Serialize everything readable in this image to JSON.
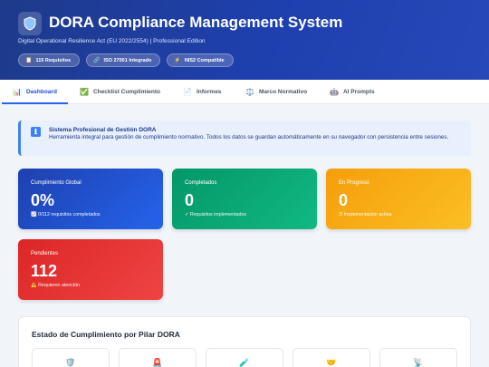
{
  "header": {
    "logo_icon": "shield-icon",
    "title": "DORA Compliance Management System",
    "subtitle": "Digital Operational Resilience Act (EU 2022/2554) | Professional Edition",
    "pills": [
      {
        "icon": "📋",
        "label": "115 Requisitos"
      },
      {
        "icon": "🔗",
        "label": "ISO 27001 Integrado"
      },
      {
        "icon": "⚡",
        "label": "NIS2 Compatible"
      }
    ]
  },
  "tabs": [
    {
      "icon": "📊",
      "label": "Dashboard",
      "active": true
    },
    {
      "icon": "✅",
      "label": "Checklist Cumplimiento"
    },
    {
      "icon": "📄",
      "label": "Informes"
    },
    {
      "icon": "⚖️",
      "label": "Marco Normativo"
    },
    {
      "icon": "🤖",
      "label": "AI Prompts"
    }
  ],
  "info": {
    "icon": "ℹ",
    "title": "Sistema Profesional de Gestión DORA",
    "text": "Herramienta integral para gestión de cumplimiento normativo. Todos los datos se guardan automáticamente en su navegador con persistencia entre sesiones."
  },
  "cards": {
    "global": {
      "label": "Cumplimiento Global",
      "value": "0%",
      "sub": "📈 0/112 requisitos completados"
    },
    "completed": {
      "label": "Completados",
      "value": "0",
      "sub": "✓ Requisitos implementados"
    },
    "progress": {
      "label": "En Progreso",
      "value": "0",
      "sub": "⏱ Implementación activa"
    },
    "pending": {
      "label": "Pendientes",
      "value": "112",
      "sub": "⚠️ Requieren atención"
    }
  },
  "pillars_panel": {
    "title": "Estado de Cumplimiento por Pilar DORA",
    "pillars": [
      {
        "icon": "🛡️"
      },
      {
        "icon": "🚨"
      },
      {
        "icon": "🧪"
      },
      {
        "icon": "🤝"
      },
      {
        "icon": "📡"
      }
    ]
  },
  "colors": {
    "header": "#1e3a8a",
    "accent": "#2563eb",
    "green": "#10b981",
    "amber": "#f59e0b",
    "red": "#dc2626"
  }
}
